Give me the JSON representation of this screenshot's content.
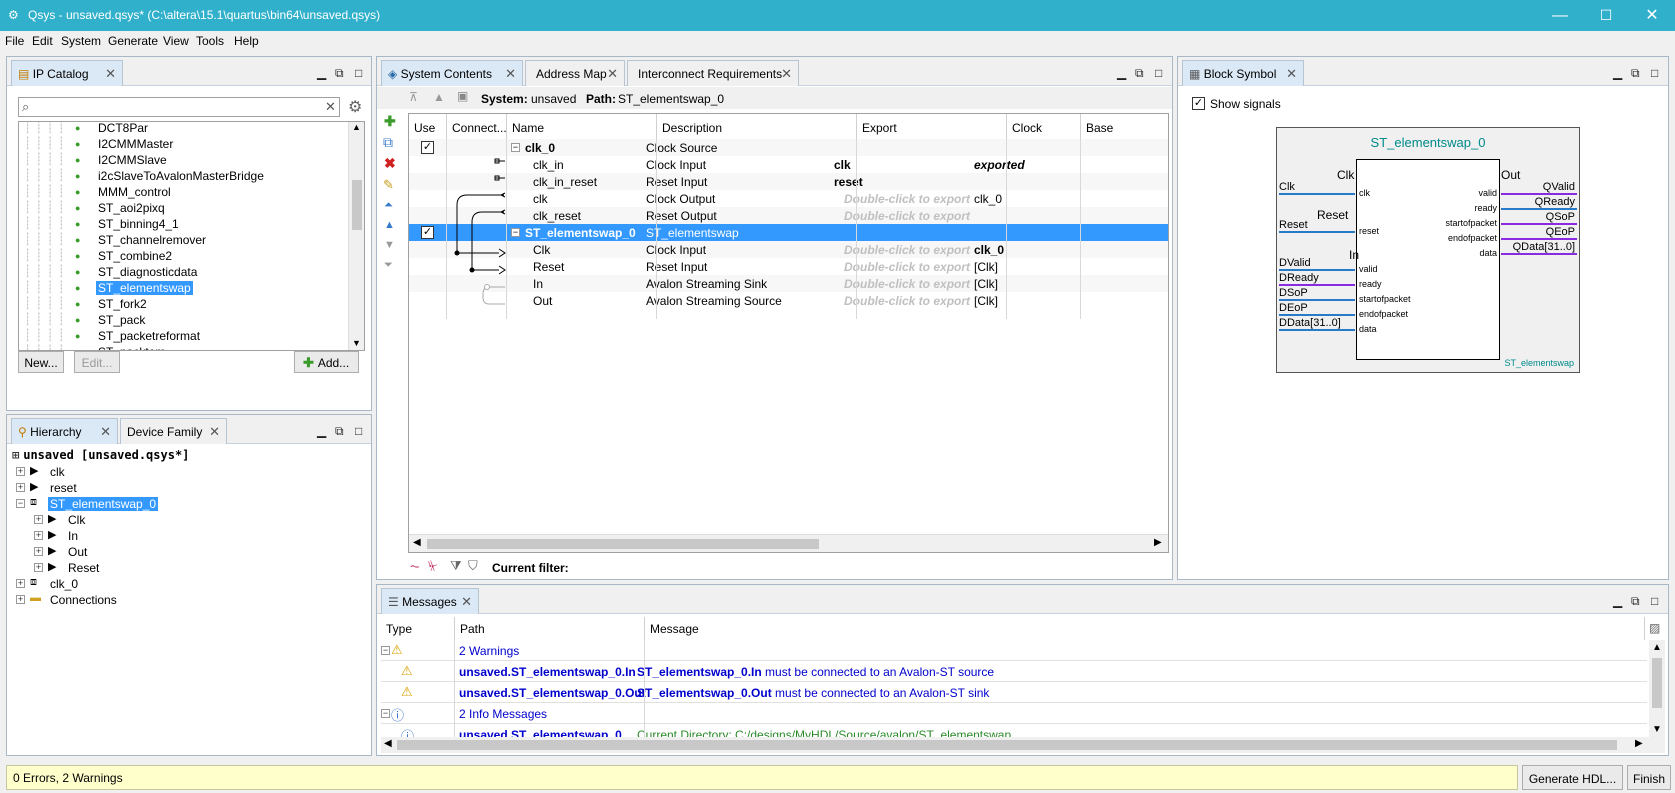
{
  "window": {
    "title": "Qsys - unsaved.qsys* (C:\\altera\\15.1\\quartus\\bin64\\unsaved.qsys)",
    "min": "—",
    "max": "☐",
    "close": "✕"
  },
  "menu": [
    "File",
    "Edit",
    "System",
    "Generate",
    "View",
    "Tools",
    "Help"
  ],
  "ip_catalog": {
    "tab": "IP Catalog",
    "search_placeholder": "",
    "items": [
      "DCT8Par",
      "I2CMMMaster",
      "I2CMMSlave",
      "i2cSlaveToAvalonMasterBridge",
      "MMM_control",
      "ST_aoi2pixq",
      "ST_binning4_1",
      "ST_channelremover",
      "ST_combine2",
      "ST_diagnosticdata",
      "ST_elementswap",
      "ST_fork2",
      "ST_pack",
      "ST_packetreformat",
      "ST_packtom"
    ],
    "selected": "ST_elementswap",
    "new_btn": "New...",
    "edit_btn": "Edit...",
    "add_btn": "Add..."
  },
  "hierarchy": {
    "tab": "Hierarchy",
    "tab2": "Device Family",
    "root": "unsaved [unsaved.qsys*]",
    "items": [
      {
        "label": "clk",
        "level": 1
      },
      {
        "label": "reset",
        "level": 1
      },
      {
        "label": "ST_elementswap_0",
        "level": 1,
        "selected": true
      },
      {
        "label": "Clk",
        "level": 2
      },
      {
        "label": "In",
        "level": 2
      },
      {
        "label": "Out",
        "level": 2
      },
      {
        "label": "Reset",
        "level": 2
      },
      {
        "label": "clk_0",
        "level": 1
      },
      {
        "label": "Connections",
        "level": 1
      }
    ]
  },
  "system": {
    "tabs": [
      "System Contents",
      "Address Map",
      "Interconnect Requirements"
    ],
    "system_label": "System:",
    "system_name": "unsaved",
    "path_label": "Path:",
    "path_value": "ST_elementswap_0",
    "columns": [
      "Use",
      "Connect...",
      "Name",
      "Description",
      "Export",
      "Clock",
      "Base"
    ],
    "rows": [
      {
        "use": true,
        "name": "clk_0",
        "desc": "Clock Source",
        "export": "",
        "clock": "",
        "bold": true,
        "group": true
      },
      {
        "name": "clk_in",
        "desc": "Clock Input",
        "export": "clk",
        "clock": "exported",
        "exp_bold": true
      },
      {
        "name": "clk_in_reset",
        "desc": "Reset Input",
        "export": "reset",
        "clock": "",
        "exp_bold": true
      },
      {
        "name": "clk",
        "desc": "Clock Output",
        "export": "Double-click to export",
        "clock": "clk_0"
      },
      {
        "name": "clk_reset",
        "desc": "Reset Output",
        "export": "Double-click to export",
        "clock": ""
      },
      {
        "use": true,
        "name": "ST_elementswap_0",
        "desc": "ST_elementswap",
        "export": "",
        "clock": "",
        "bold": true,
        "group": true,
        "selected": true
      },
      {
        "name": "Clk",
        "desc": "Clock Input",
        "export": "Double-click to export",
        "clock": "clk_0"
      },
      {
        "name": "Reset",
        "desc": "Reset Input",
        "export": "Double-click to export",
        "clock": "[Clk]"
      },
      {
        "name": "In",
        "desc": "Avalon Streaming Sink",
        "export": "Double-click to export",
        "clock": "[Clk]"
      },
      {
        "name": "Out",
        "desc": "Avalon Streaming Source",
        "export": "Double-click to export",
        "clock": "[Clk]"
      }
    ],
    "filter_label": "Current filter:"
  },
  "block": {
    "tab": "Block Symbol",
    "show_signals": "Show signals",
    "title": "ST_elementswap_0",
    "footer": "ST_elementswap",
    "left_groups": [
      "Clk",
      "Reset",
      "In"
    ],
    "right_group": "Out",
    "left_ext": [
      "Clk",
      "Reset",
      "DValid",
      "DReady",
      "DSoP",
      "DEoP",
      "DData[31..0]"
    ],
    "left_int": [
      "clk",
      "reset",
      "valid",
      "ready",
      "startofpacket",
      "endofpacket",
      "data"
    ],
    "right_int": [
      "valid",
      "ready",
      "startofpacket",
      "endofpacket",
      "data"
    ],
    "right_ext": [
      "QValid",
      "QReady",
      "QSoP",
      "QEoP",
      "QData[31..0]"
    ]
  },
  "messages": {
    "tab": "Messages",
    "columns": [
      "Type",
      "Path",
      "Message"
    ],
    "rows": [
      {
        "kind": "group",
        "text": "2 Warnings"
      },
      {
        "kind": "warn",
        "path": "unsaved.ST_elementswap_0.In",
        "msg_bold": "ST_elementswap_0.In",
        "msg": " must be connected to an Avalon-ST source"
      },
      {
        "kind": "warn",
        "path": "unsaved.ST_elementswap_0.Out",
        "msg_bold": "ST_elementswap_0.Out",
        "msg": " must be connected to an Avalon-ST sink"
      },
      {
        "kind": "group",
        "text": "2 Info Messages"
      },
      {
        "kind": "info",
        "path": "unsaved.ST_elementswap_0",
        "msg": "Current Directory: C:/designs/MyHDL/Source/avalon/ST_elementswap"
      }
    ]
  },
  "status": {
    "text": "0 Errors, 2 Warnings",
    "generate_btn": "Generate HDL...",
    "finish_btn": "Finish"
  },
  "colors": {
    "titlebar": "#31b0cb",
    "selection": "#3399ff",
    "teal": "#008a8a",
    "warning_bg": "#ffffcc"
  }
}
